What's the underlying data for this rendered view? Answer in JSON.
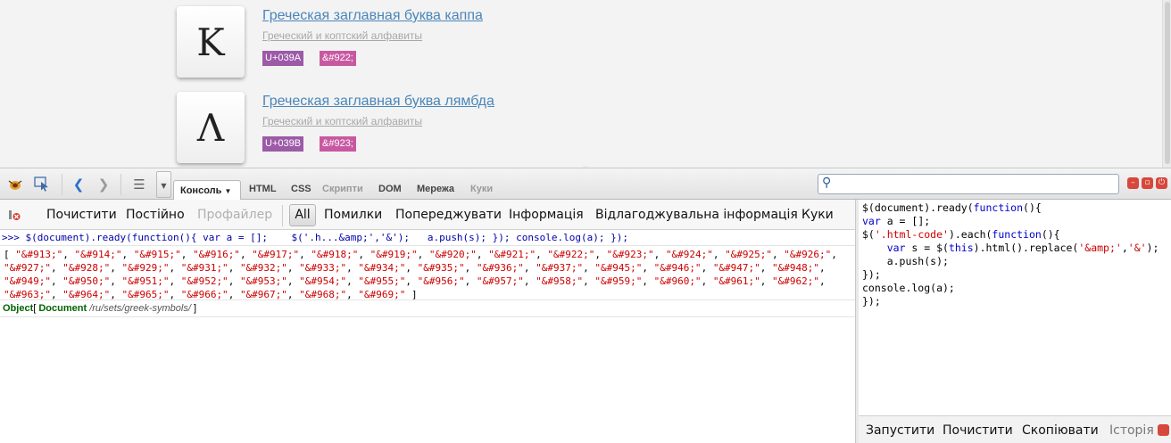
{
  "webpage": {
    "cards": [
      {
        "glyph": "Κ",
        "title": "Греческая заглавная буква каппа",
        "subtitle": "Греческий и коптский алфавиты",
        "unicode": "U+039A",
        "html": "&#922;"
      },
      {
        "glyph": "Λ",
        "title": "Греческая заглавная буква лямбда",
        "subtitle": "Греческий и коптский алфавиты",
        "unicode": "U+039B",
        "html": "&#923;"
      }
    ]
  },
  "toolbar": {
    "active_tab": "Консоль",
    "tabs": [
      "HTML",
      "CSS",
      "Скрипти",
      "DOM",
      "Мережа",
      "Куки"
    ],
    "search_placeholder": ""
  },
  "filters": {
    "clear": "Почистити",
    "persist": "Постійно",
    "profiler": "Профайлер",
    "all": "All",
    "errors": "Помилки",
    "warnings": "Попереджувати",
    "info": "Інформація",
    "debug": "Відлагоджувальна інформація",
    "cookies": "Куки"
  },
  "console": {
    "command": ">>> $(document).ready(function(){ var a = [];    $('.h...&amp;','&');   a.push(s); }); console.log(a); });",
    "array_items": [
      "&#913;",
      "&#914;",
      "&#915;",
      "&#916;",
      "&#917;",
      "&#918;",
      "&#919;",
      "&#920;",
      "&#921;",
      "&#922;",
      "&#923;",
      "&#924;",
      "&#925;",
      "&#926;",
      "&#927;",
      "&#928;",
      "&#929;",
      "&#931;",
      "&#932;",
      "&#933;",
      "&#934;",
      "&#935;",
      "&#936;",
      "&#937;",
      "&#945;",
      "&#946;",
      "&#947;",
      "&#948;",
      "&#949;",
      "&#950;",
      "&#951;",
      "&#952;",
      "&#953;",
      "&#954;",
      "&#955;",
      "&#956;",
      "&#957;",
      "&#958;",
      "&#959;",
      "&#960;",
      "&#961;",
      "&#962;",
      "&#963;",
      "&#964;",
      "&#965;",
      "&#966;",
      "&#967;",
      "&#968;",
      "&#969;"
    ],
    "object_label": "Object",
    "object_doc": "Document",
    "object_path": "/ru/sets/greek-symbols/"
  },
  "editor": {
    "lines": [
      "$(document).ready(function(){",
      "var a = [];",
      "$('.html-code').each(function(){",
      "    var s = $(this).html().replace('&amp;','&');",
      "    a.push(s);",
      "});",
      "console.log(a);",
      "});"
    ],
    "run": "Запустити",
    "clear": "Почистити",
    "copy": "Скопіювати",
    "history": "Історія"
  },
  "colors": {
    "link": "#4a86b9",
    "badge_unicode": "#9c5aa7",
    "badge_html": "#c859a1",
    "string_red": "#cc0000",
    "keyword_blue": "#0000cc"
  },
  "icons": [
    "firebug-icon",
    "inspect-icon",
    "back-icon",
    "forward-icon",
    "list-icon",
    "clear-console-icon",
    "search-icon"
  ]
}
